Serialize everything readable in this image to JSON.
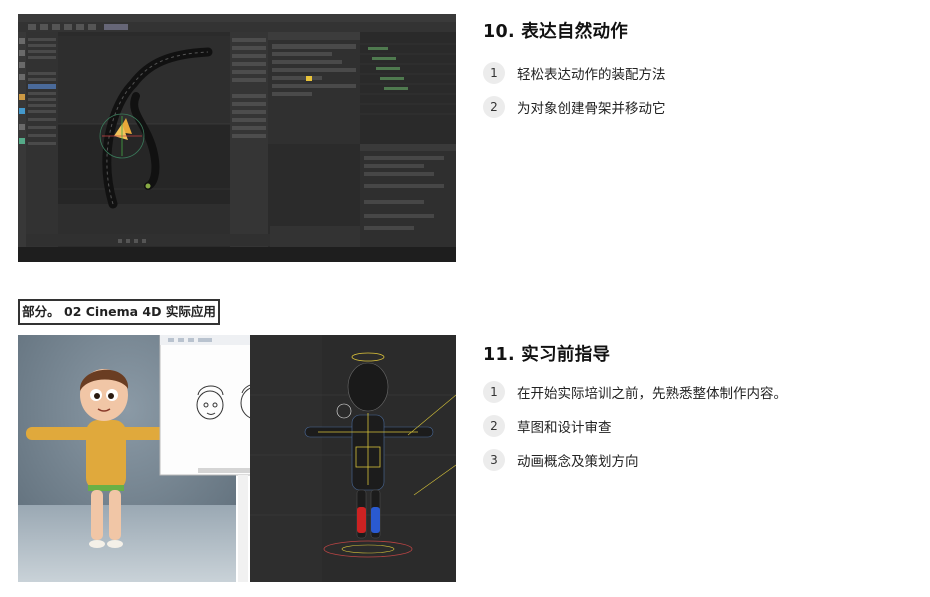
{
  "lesson10": {
    "title": "10. 表达自然动作",
    "items": [
      {
        "num": "1",
        "text": "轻松表达动作的装配方法"
      },
      {
        "num": "2",
        "text": "为对象创建骨架并移动它"
      }
    ]
  },
  "section_tag": "部分。 02 Cinema 4D 实际应用",
  "lesson11": {
    "title": "11. 实习前指导",
    "items": [
      {
        "num": "1",
        "text": "在开始实际培训之前，先熟悉整体制作内容。"
      },
      {
        "num": "2",
        "text": "草图和设计审查"
      },
      {
        "num": "3",
        "text": "动画概念及策划方向"
      }
    ]
  },
  "colors": {
    "ui_dark": "#2b2b2b",
    "badge_bg": "#ececec",
    "bone_orange": "#e8a83a",
    "character_yellow": "#e0a93c"
  }
}
